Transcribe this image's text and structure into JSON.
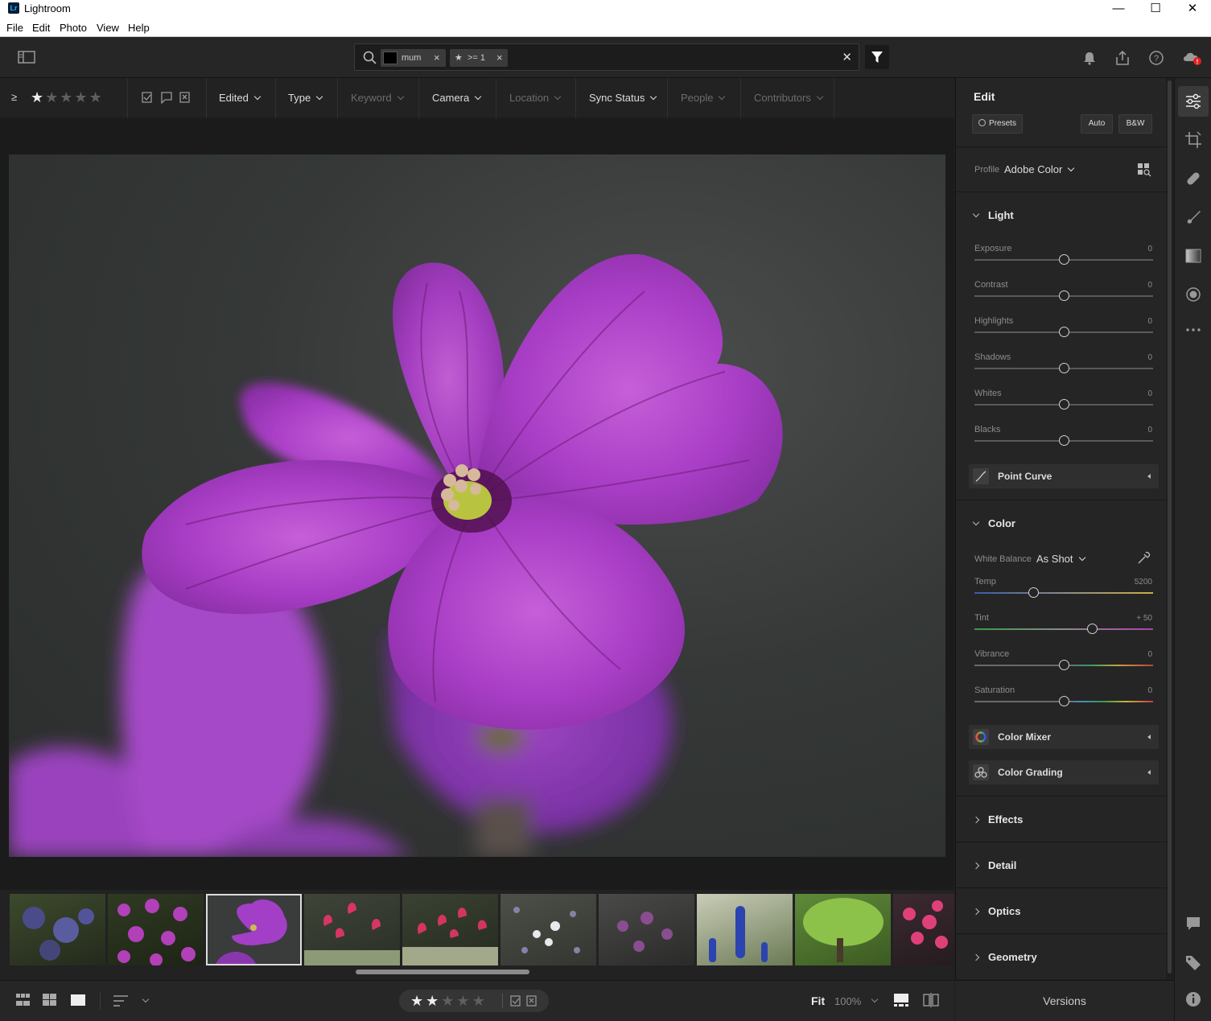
{
  "window": {
    "app_icon": "Lr",
    "title": "Lightroom",
    "minimize": "—",
    "maximize": "☐",
    "close": "✕"
  },
  "menu": [
    "File",
    "Edit",
    "Photo",
    "View",
    "Help"
  ],
  "search": {
    "chip1": "mum",
    "chip2": ">= 1",
    "chip_close": "×",
    "clear": "✕"
  },
  "filters": {
    "rating_op": "≥",
    "edited": "Edited",
    "type": "Type",
    "keyword": "Keyword",
    "camera": "Camera",
    "location": "Location",
    "sync_status": "Sync Status",
    "people": "People",
    "contributors": "Contributors"
  },
  "edit": {
    "title": "Edit",
    "presets": "Presets",
    "auto": "Auto",
    "bw": "B&W",
    "profile_label": "Profile",
    "profile_value": "Adobe Color",
    "light": "Light",
    "point_curve": "Point Curve",
    "color": "Color",
    "wb_label": "White Balance",
    "wb_value": "As Shot",
    "color_mixer": "Color Mixer",
    "color_grading": "Color Grading",
    "effects": "Effects",
    "detail": "Detail",
    "optics": "Optics",
    "geometry": "Geometry"
  },
  "light_sliders": [
    {
      "label": "Exposure",
      "value": "0",
      "pos": 0.5
    },
    {
      "label": "Contrast",
      "value": "0",
      "pos": 0.5
    },
    {
      "label": "Highlights",
      "value": "0",
      "pos": 0.5
    },
    {
      "label": "Shadows",
      "value": "0",
      "pos": 0.5
    },
    {
      "label": "Whites",
      "value": "0",
      "pos": 0.5
    },
    {
      "label": "Blacks",
      "value": "0",
      "pos": 0.5
    }
  ],
  "color_sliders": [
    {
      "label": "Temp",
      "value": "5200",
      "pos": 0.33
    },
    {
      "label": "Tint",
      "value": "+ 50",
      "pos": 0.66
    },
    {
      "label": "Vibrance",
      "value": "0",
      "pos": 0.5
    },
    {
      "label": "Saturation",
      "value": "0",
      "pos": 0.5
    }
  ],
  "bottom": {
    "fit": "Fit",
    "zoom": "100%",
    "versions": "Versions"
  },
  "rating": {
    "top_stars": 1,
    "bottom_stars": 2
  },
  "colors": {
    "accent_purple": "#b43fd0",
    "panel_bg": "#252525"
  }
}
